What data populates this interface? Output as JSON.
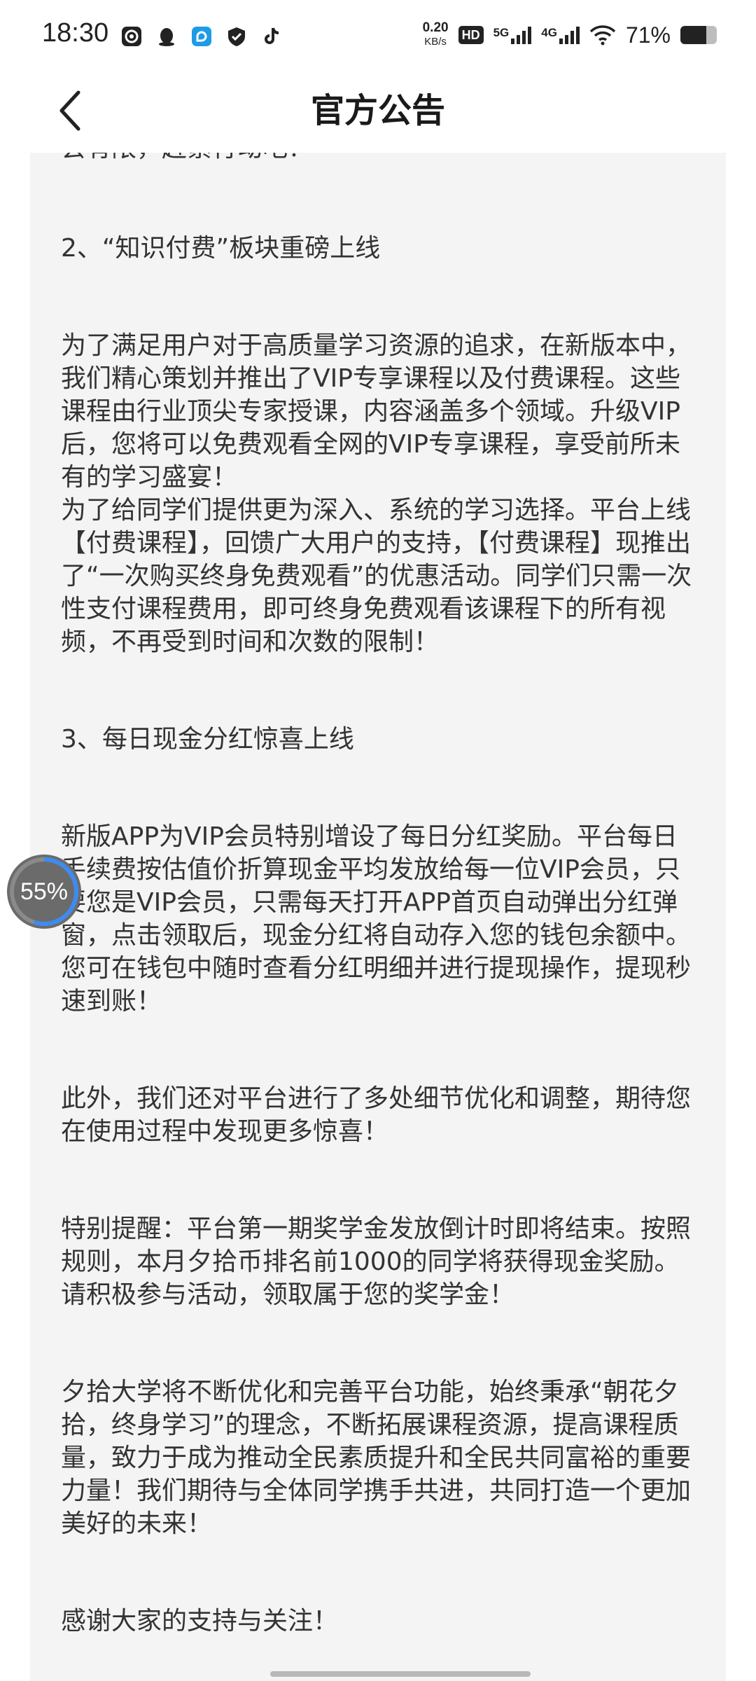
{
  "status_bar": {
    "time": "18:30",
    "net_speed_value": "0.20",
    "net_speed_unit": "KB/s",
    "hd_label": "HD",
    "signal_1_label": "5G",
    "signal_2_label": "4G",
    "battery_text": "71%",
    "battery_level": 0.71,
    "icons": [
      "dashcam-icon",
      "qq-penguin-icon",
      "app-icon",
      "shield-check-icon",
      "tiktok-icon",
      "wifi-icon",
      "battery-icon"
    ]
  },
  "nav": {
    "title": "官方公告",
    "back_icon": "chevron-left-icon"
  },
  "article": {
    "paragraphs": [
      "会有限，赶紧行动吧！",
      "2、“知识付费”板块重磅上线",
      "为了满足用户对于高质量学习资源的追求，在新版本中，我们精心策划并推出了VIP专享课程以及付费课程。这些课程由行业顶尖专家授课，内容涵盖多个领域。升级VIP后，您将可以免费观看全网的VIP专享课程，享受前所未有的学习盛宴！",
      "为了给同学们提供更为深入、系统的学习选择。平台上线【付费课程】，回馈广大用户的支持，【付费课程】现推出了“一次购买终身免费观看”的优惠活动。同学们只需一次性支付课程费用，即可终身免费观看该课程下的所有视频，不再受到时间和次数的限制！",
      "3、每日现金分红惊喜上线",
      "新版APP为VIP会员特别增设了每日分红奖励。平台每日手续费按估值价折算现金平均发放给每一位VIP会员，只要您是VIP会员，只需每天打开APP首页自动弹出分红弹窗，点击领取后，现金分红将自动存入您的钱包余额中。您可在钱包中随时查看分红明细并进行提现操作，提现秒速到账！",
      "此外，我们还对平台进行了多处细节优化和调整，期待您在使用过程中发现更多惊喜！",
      "特别提醒：平台第一期奖学金发放倒计时即将结束。按照规则，本月夕拾币排名前1000的同学将获得现金奖励。请积极参与活动，领取属于您的奖学金！",
      "夕拾大学将不断优化和完善平台功能，始终秉承“朝花夕拾，终身学习”的理念，不断拓展课程资源，提高课程质量，致力于成为推动全民素质提升和全民共同富裕的重要力量！我们期待与全体同学携手共进，共同打造一个更加美好的未来！",
      "感谢大家的支持与关注！"
    ]
  },
  "float_widget": {
    "progress_text": "55%",
    "progress_value": 0.55
  },
  "colors": {
    "card_background": "#f4f4f4",
    "text": "#333333",
    "title": "#1a1a1a",
    "progress_accent": "#3d8bf2"
  }
}
